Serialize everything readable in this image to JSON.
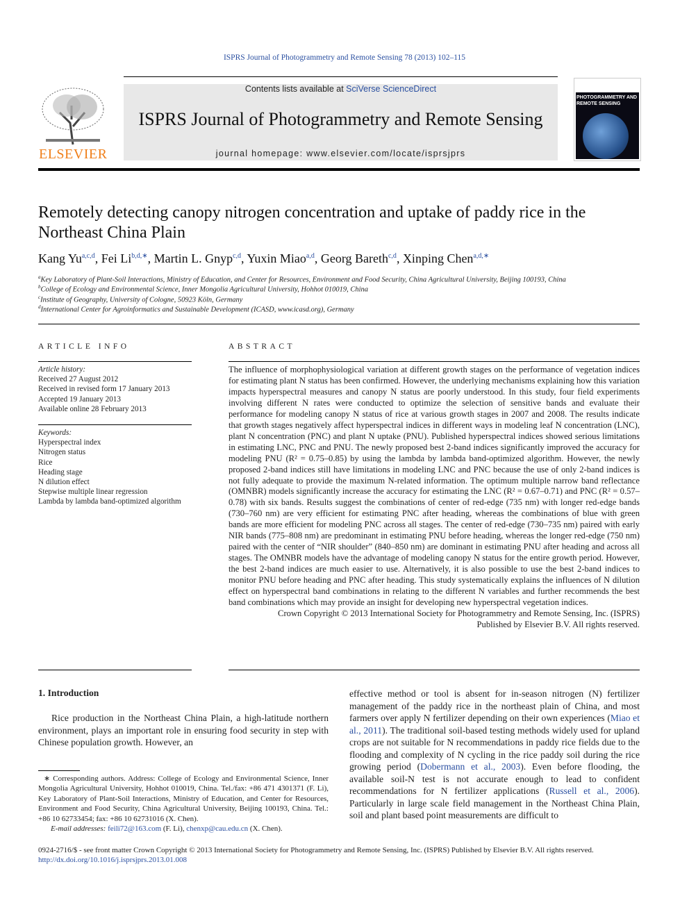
{
  "header": {
    "citation": "ISPRS Journal of Photogrammetry and Remote Sensing 78 (2013) 102–115",
    "contents_prefix": "Contents lists available at ",
    "contents_link": "SciVerse ScienceDirect",
    "journal_title": "ISPRS Journal of Photogrammetry and Remote Sensing",
    "homepage_prefix": "journal homepage: ",
    "homepage_url": "www.elsevier.com/locate/isprsjprs",
    "publisher_logo": "ELSEVIER",
    "cover_title": "PHOTOGRAMMETRY AND REMOTE SENSING"
  },
  "article": {
    "title": "Remotely detecting canopy nitrogen concentration and uptake of paddy rice in the Northeast China Plain",
    "authors": [
      {
        "name": "Kang Yu",
        "sup": "a,c,d"
      },
      {
        "name": "Fei Li",
        "sup": "b,d,∗"
      },
      {
        "name": "Martin L. Gnyp",
        "sup": "c,d"
      },
      {
        "name": "Yuxin Miao",
        "sup": "a,d"
      },
      {
        "name": "Georg Bareth",
        "sup": "c,d"
      },
      {
        "name": "Xinping Chen",
        "sup": "a,d,∗"
      }
    ],
    "affiliations": [
      {
        "label": "a",
        "text": "Key Laboratory of Plant-Soil Interactions, Ministry of Education, and Center for Resources, Environment and Food Security, China Agricultural University, Beijing 100193, China"
      },
      {
        "label": "b",
        "text": "College of Ecology and Environmental Science, Inner Mongolia Agricultural University, Hohhot 010019, China"
      },
      {
        "label": "c",
        "text": "Institute of Geography, University of Cologne, 50923 Köln, Germany"
      },
      {
        "label": "d",
        "text": "International Center for Agroinformatics and Sustainable Development (ICASD, www.icasd.org), Germany"
      }
    ]
  },
  "article_info": {
    "heading": "ARTICLE INFO",
    "history_label": "Article history:",
    "history": [
      "Received 27 August 2012",
      "Received in revised form 17 January 2013",
      "Accepted 19 January 2013",
      "Available online 28 February 2013"
    ],
    "keywords_label": "Keywords:",
    "keywords": [
      "Hyperspectral index",
      "Nitrogen status",
      "Rice",
      "Heading stage",
      "N dilution effect",
      "Stepwise multiple linear regression",
      "Lambda by lambda band-optimized algorithm"
    ]
  },
  "abstract": {
    "heading": "ABSTRACT",
    "text": "The influence of morphophysiological variation at different growth stages on the performance of vegetation indices for estimating plant N status has been confirmed. However, the underlying mechanisms explaining how this variation impacts hyperspectral measures and canopy N status are poorly understood. In this study, four field experiments involving different N rates were conducted to optimize the selection of sensitive bands and evaluate their performance for modeling canopy N status of rice at various growth stages in 2007 and 2008. The results indicate that growth stages negatively affect hyperspectral indices in different ways in modeling leaf N concentration (LNC), plant N concentration (PNC) and plant N uptake (PNU). Published hyperspectral indices showed serious limitations in estimating LNC, PNC and PNU. The newly proposed best 2-band indices significantly improved the accuracy for modeling PNU (R² = 0.75–0.85) by using the lambda by lambda band-optimized algorithm. However, the newly proposed 2-band indices still have limitations in modeling LNC and PNC because the use of only 2-band indices is not fully adequate to provide the maximum N-related information. The optimum multiple narrow band reflectance (OMNBR) models significantly increase the accuracy for estimating the LNC (R² = 0.67–0.71) and PNC (R² = 0.57–0.78) with six bands. Results suggest the combinations of center of red-edge (735 nm) with longer red-edge bands (730–760 nm) are very efficient for estimating PNC after heading, whereas the combinations of blue with green bands are more efficient for modeling PNC across all stages. The center of red-edge (730–735 nm) paired with early NIR bands (775–808 nm) are predominant in estimating PNU before heading, whereas the longer red-edge (750 nm) paired with the center of “NIR shoulder” (840–850 nm) are dominant in estimating PNU after heading and across all stages. The OMNBR models have the advantage of modeling canopy N status for the entire growth period. However, the best 2-band indices are much easier to use. Alternatively, it is also possible to use the best 2-band indices to monitor PNU before heading and PNC after heading. This study systematically explains the influences of N dilution effect on hyperspectral band combinations in relating to the different N variables and further recommends the best band combinations which may provide an insight for developing new hyperspectral vegetation indices.",
    "copyright1": "Crown Copyright © 2013 International Society for Photogrammetry and Remote Sensing, Inc. (ISPRS)",
    "copyright2": "Published by Elsevier B.V. All rights reserved."
  },
  "introduction": {
    "heading": "1. Introduction",
    "left_text": "Rice production in the Northeast China Plain, a high-latitude northern environment, plays an important role in ensuring food security in step with Chinese population growth. However, an",
    "right_parts": [
      "effective method or tool is absent for in-season nitrogen (N) fertilizer management of the paddy rice in the northeast plain of China, and most farmers over apply N fertilizer depending on their own experiences (",
      "Miao et al., 2011",
      "). The traditional soil-based testing methods widely used for upland crops are not suitable for N recommendations in paddy rice fields due to the flooding and complexity of N cycling in the rice paddy soil during the rice growing period (",
      "Dobermann et al., 2003",
      "). Even before flooding, the available soil-N test is not accurate enough to lead to confident recommendations for N fertilizer applications (",
      "Russell et al., 2006",
      "). Particularly in large scale field management in the Northeast China Plain, soil and plant based point measurements are difficult to"
    ]
  },
  "footnote": {
    "text": "∗ Corresponding authors. Address: College of Ecology and Environmental Science, Inner Mongolia Agricultural University, Hohhot 010019, China. Tel./fax: +86 471 4301371 (F. Li), Key Laboratory of Plant-Soil Interactions, Ministry of Education, and Center for Resources, Environment and Food Security, China Agricultural University, Beijing 100193, China. Tel.: +86 10 62733454; fax: +86 10 62731016 (X. Chen).",
    "email_label": "E-mail addresses: ",
    "email1": "feili72@163.com",
    "email1_name": " (F. Li), ",
    "email2": "chenxp@cau.edu.cn",
    "email2_name": " (X. Chen)."
  },
  "footer": {
    "issn_line": "0924-2716/$ - see front matter Crown Copyright © 2013 International Society for Photogrammetry and Remote Sensing, Inc. (ISPRS) Published by Elsevier B.V. All rights reserved.",
    "doi": "http://dx.doi.org/10.1016/j.isprsjprs.2013.01.008"
  }
}
